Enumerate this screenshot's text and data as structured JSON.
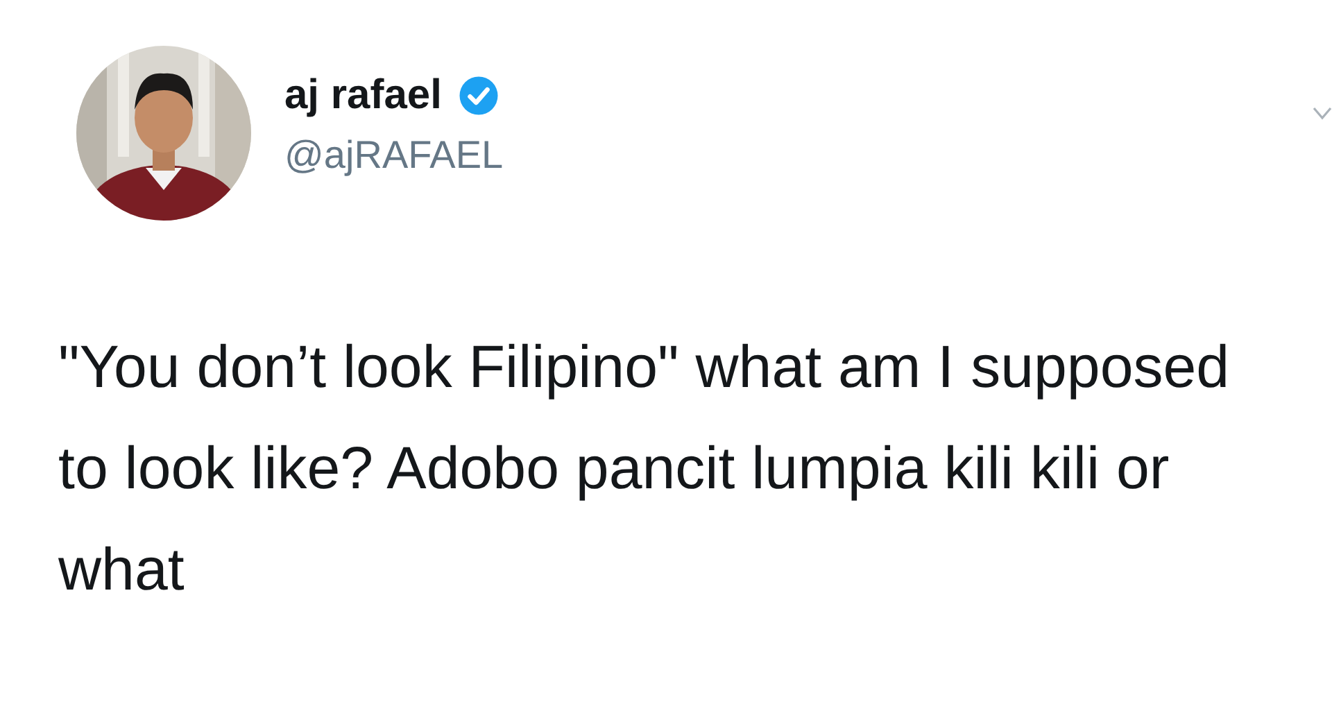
{
  "author": {
    "name": "aj rafael",
    "verified": true,
    "handle": "@ajRAFAEL"
  },
  "tweet": {
    "text": "\"You don’t look Filipino\" what am I supposed to look like? Adobo pancit lumpia kili kili or what"
  }
}
